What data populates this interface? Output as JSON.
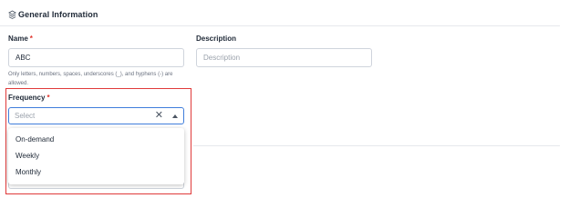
{
  "section": {
    "title": "General Information",
    "icon": "layers-icon"
  },
  "name_field": {
    "label": "Name",
    "required_mark": "*",
    "value": "ABC",
    "hint": "Only letters, numbers, spaces, underscores (_), and hyphens (-) are allowed."
  },
  "description_field": {
    "label": "Description",
    "placeholder": "Description"
  },
  "frequency_field": {
    "label": "Frequency",
    "required_mark": "*",
    "placeholder": "Select",
    "clear_glyph": "✕",
    "options": [
      "On-demand",
      "Weekly",
      "Monthly"
    ]
  },
  "colors": {
    "required": "#e0342c",
    "focus_border": "#3f7ddb",
    "highlight_frame": "#e03a3a"
  }
}
